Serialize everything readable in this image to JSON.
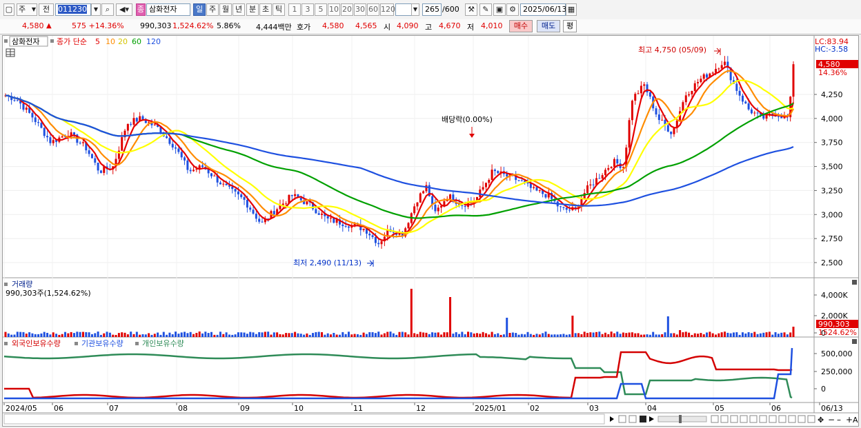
{
  "toolbar": {
    "market_label": "주",
    "prev_label": "전",
    "code": "011230",
    "name_badge": "종",
    "name": "삼화전자",
    "periods": [
      "일",
      "주",
      "월",
      "년",
      "분",
      "초",
      "틱"
    ],
    "active_period": "일",
    "intervals": [
      "1",
      "3",
      "5",
      "10",
      "20",
      "30",
      "60",
      "120"
    ],
    "count": "265",
    "count_total": "/600",
    "date": "2025/06/13"
  },
  "quote": {
    "price": "4,580",
    "change": "575 ▲ +14.36%",
    "change_arrow": "▲",
    "change_pct": "+14.36%",
    "volume": "990,303",
    "volume_ratio": "1,524.62%",
    "turnover": "5.86%",
    "amount": "4,444백만",
    "quote_label": "호가",
    "ask": "4,580",
    "bid": "4,565",
    "open_label": "시",
    "open": "4,090",
    "high_label": "고",
    "high": "4,670",
    "low_label": "저",
    "low": "4,010",
    "buy_label": "매수",
    "sell_label": "매도",
    "eval_label": "평"
  },
  "price_pane": {
    "stock_tag": "삼화전자",
    "legend_prefix": "종가 단순",
    "ma_periods": [
      "5",
      "10",
      "20",
      "60",
      "120"
    ],
    "ma_colors": [
      "#e60000",
      "#ff8c00",
      "#ffff00",
      "#00a000",
      "#1e50e0"
    ],
    "lc": "LC:83.94",
    "hc": "HC:-3.58",
    "current_price": "4,580",
    "current_pct": "14.36%",
    "high_note": "최고 4,750 (05/09)",
    "low_note": "최저 2,490 (11/13)",
    "dividend_note": "배당락(0.00%)",
    "y_ticks": [
      "4,250",
      "4,000",
      "3,750",
      "3,500",
      "3,250",
      "3,000",
      "2,750",
      "2,500"
    ]
  },
  "volume_pane": {
    "title": "거래량",
    "value": "990,303주(1,524.62%)",
    "y_ticks": [
      "4,000K",
      "2,000K",
      "0"
    ],
    "last_label": "990,303",
    "last_ratio": "1524.62%"
  },
  "holders_pane": {
    "series": [
      "외국인보유수량",
      "기관보유수량",
      "개인보유수량"
    ],
    "colors": [
      "#d40000",
      "#1e50e0",
      "#2e8b57"
    ],
    "y_ticks": [
      "500,000",
      "250,000",
      "0"
    ]
  },
  "x_axis": {
    "labels": [
      "2024/05",
      "06",
      "07",
      "08",
      "09",
      "10",
      "11",
      "12",
      "2025/01",
      "02",
      "03",
      "04",
      "05",
      "06",
      "06/13"
    ]
  }
}
